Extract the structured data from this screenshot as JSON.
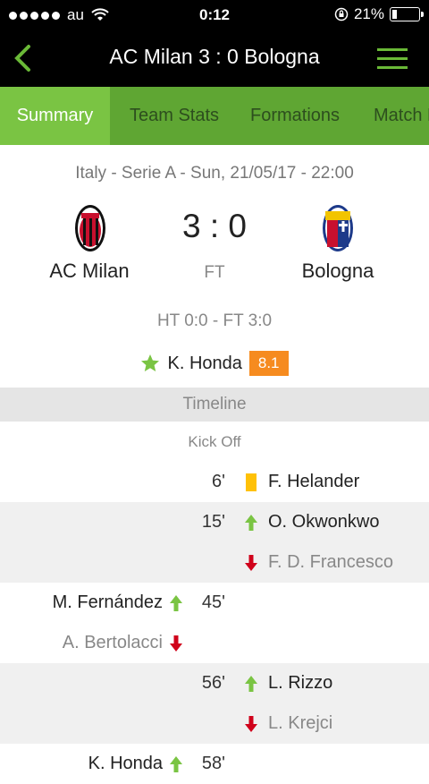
{
  "status": {
    "carrier": "au",
    "time": "0:12",
    "battery": "21%",
    "battery_level": 0.21
  },
  "nav": {
    "title": "AC Milan 3 : 0 Bologna"
  },
  "tabs": [
    {
      "label": "Summary"
    },
    {
      "label": "Team Stats"
    },
    {
      "label": "Formations"
    },
    {
      "label": "Match F"
    }
  ],
  "match": {
    "league": "Italy - Serie A - Sun, 21/05/17 - 22:00",
    "score": "3 : 0",
    "status": "FT",
    "home": "AC Milan",
    "away": "Bologna",
    "halftime": "HT 0:0 - FT 3:0",
    "motm_name": "K. Honda",
    "motm_rating": "8.1"
  },
  "timeline": {
    "title": "Timeline",
    "kickoff": "Kick Off",
    "events": [
      {
        "minute": "6'",
        "side": "away",
        "icon": "yellow-card-icon",
        "player": "F. Helander"
      },
      {
        "minute": "15'",
        "side": "away",
        "icon": "sub-in-icon",
        "player": "O. Okwonkwo",
        "player_out": "F. D. Francesco"
      },
      {
        "minute": "45'",
        "side": "home",
        "icon": "sub-in-icon",
        "player": "M. Fernández",
        "player_out": "A. Bertolacci"
      },
      {
        "minute": "56'",
        "side": "away",
        "icon": "sub-in-icon",
        "player": "L. Rizzo",
        "player_out": "L. Krejci"
      },
      {
        "minute": "58'",
        "side": "home",
        "icon": "sub-in-icon",
        "player": "K. Honda"
      }
    ]
  },
  "colors": {
    "accent": "#6ab937",
    "rating": "#f68b1f",
    "yellow": "#ffc107",
    "sub_in": "#7ac443",
    "sub_out": "#d0021b"
  }
}
